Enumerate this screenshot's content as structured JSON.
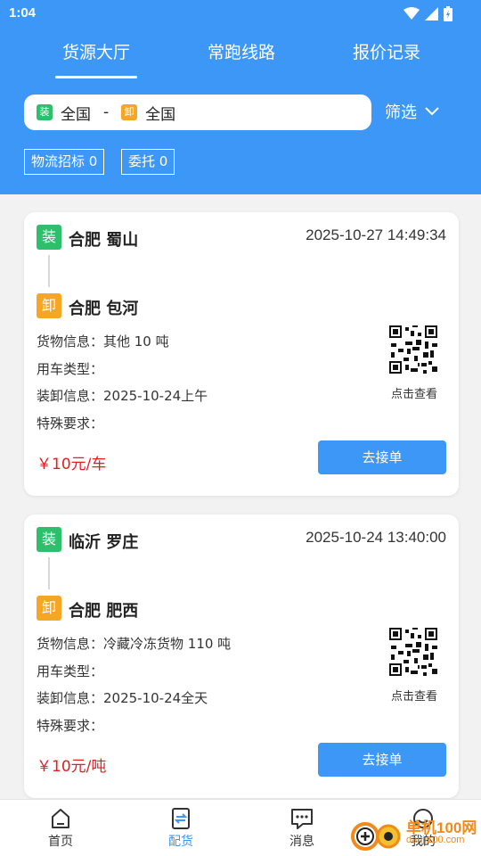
{
  "status_bar": {
    "time": "1:04"
  },
  "header": {
    "tabs": [
      {
        "label": "货源大厅",
        "active": true
      },
      {
        "label": "常跑线路",
        "active": false
      },
      {
        "label": "报价记录",
        "active": false
      }
    ],
    "route": {
      "load_tag": "装",
      "from": "全国",
      "separator": "-",
      "unload_tag": "卸",
      "to": "全国"
    },
    "filter_label": "筛选",
    "pills": [
      "物流招标 0",
      "委托 0"
    ]
  },
  "cards": [
    {
      "load_tag": "装",
      "load_city": "合肥 蜀山",
      "time": "2025-10-27 14:49:34",
      "unload_tag": "卸",
      "unload_city": "合肥 包河",
      "cargo": "货物信息：其他 10 吨",
      "vehicle": "用车类型：",
      "handling": "装卸信息：2025-10-24上午",
      "special": "特殊要求：",
      "qr_label": "点击查看",
      "price": "￥10元/车",
      "button": "去接单"
    },
    {
      "load_tag": "装",
      "load_city": "临沂 罗庄",
      "time": "2025-10-24 13:40:00",
      "unload_tag": "卸",
      "unload_city": "合肥 肥西",
      "cargo": "货物信息：冷藏冷冻货物 110 吨",
      "vehicle": "用车类型：",
      "handling": "装卸信息：2025-10-24全天",
      "special": "特殊要求：",
      "qr_label": "点击查看",
      "price": "￥10元/吨",
      "button": "去接单"
    }
  ],
  "bottom_nav": [
    {
      "label": "首页",
      "icon": "home-icon",
      "active": false
    },
    {
      "label": "配货",
      "icon": "dispatch-icon",
      "active": true
    },
    {
      "label": "消息",
      "icon": "message-icon",
      "active": false
    },
    {
      "label": "我的",
      "icon": "profile-icon",
      "active": false
    }
  ],
  "watermark": {
    "name": "单机100网",
    "url": "danji100.com"
  },
  "colors": {
    "primary": "#3d97f7",
    "load_tag": "#2dbf6b",
    "unload_tag": "#f5a623",
    "price": "#e02020"
  }
}
